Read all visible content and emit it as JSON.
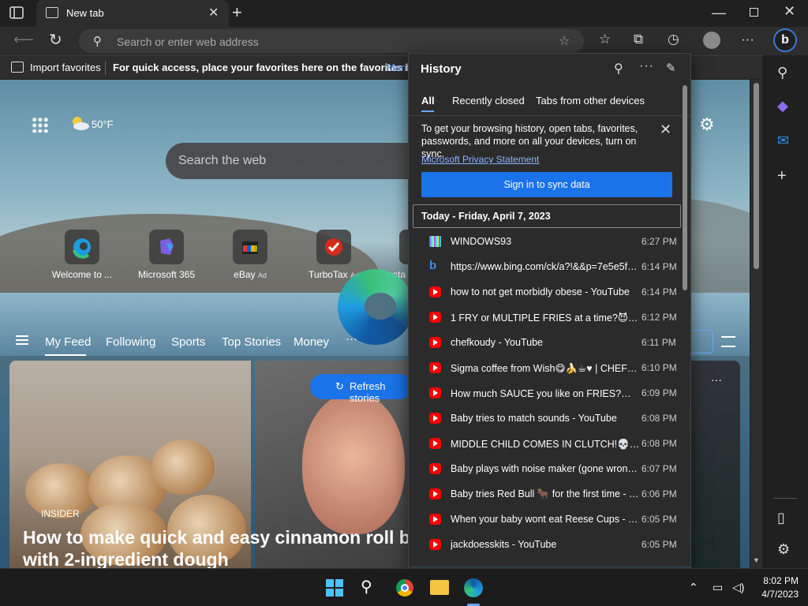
{
  "browser": {
    "tab_title": "New tab",
    "address_placeholder": "Search or enter web address"
  },
  "favorites_bar": {
    "import_label": "Import favorites",
    "hint": "For quick access, place your favorites here on the favorites bar.",
    "manage_link": "Mana"
  },
  "newtab": {
    "weather_temp": "50°F",
    "search_placeholder": "Search the web",
    "quick_links": [
      {
        "label": "Welcome to ...",
        "tag": ""
      },
      {
        "label": "Microsoft 365",
        "tag": ""
      },
      {
        "label": "eBay",
        "tag": "Ad"
      },
      {
        "label": "TurboTax",
        "tag": "Ad"
      },
      {
        "label": "Insta",
        "tag": ""
      }
    ],
    "feed_tabs": [
      "My Feed",
      "Following",
      "Sports",
      "Top Stories",
      "Money"
    ],
    "feed_more": "···",
    "refresh_label": "Refresh stories",
    "card_more": "···",
    "news_source": "INSIDER",
    "news_title": "How to make quick and easy cinnamon roll b with 2-ingredient dough"
  },
  "history": {
    "title": "History",
    "tabs": [
      "All",
      "Recently closed",
      "Tabs from other devices"
    ],
    "sync_message": "To get your browsing history, open tabs, favorites, passwords, and more on all your devices, turn on sync.",
    "privacy_link": "Microsoft Privacy Statement",
    "sign_in_label": "Sign in to sync data",
    "date_header": "Today - Friday, April 7, 2023",
    "items": [
      {
        "title": "WINDOWS93",
        "time": "6:27 PM",
        "icon": "windows93-icon"
      },
      {
        "title": "https://www.bing.com/ck/a?!&&p=7e5e5f9...",
        "time": "6:14 PM",
        "icon": "bing-icon"
      },
      {
        "title": "how to not get morbidly obese - YouTube",
        "time": "6:14 PM",
        "icon": "youtube-icon"
      },
      {
        "title": "1 FRY or MULTIPLE FRIES at a time?😈🔥 ...",
        "time": "6:12 PM",
        "icon": "youtube-icon"
      },
      {
        "title": "chefkoudy - YouTube",
        "time": "6:11 PM",
        "icon": "youtube-icon"
      },
      {
        "title": "Sigma coffee from Wish😋🍌☕♥ | CHEFK...",
        "time": "6:10 PM",
        "icon": "youtube-icon"
      },
      {
        "title": "How much SAUCE you like on FRIES?😋🍌 ...",
        "time": "6:09 PM",
        "icon": "youtube-icon"
      },
      {
        "title": "Baby tries to match sounds - YouTube",
        "time": "6:08 PM",
        "icon": "youtube-icon"
      },
      {
        "title": "MIDDLE CHILD COMES IN CLUTCH!💀😂 ...",
        "time": "6:08 PM",
        "icon": "youtube-icon"
      },
      {
        "title": "Baby plays with noise maker (gone wrong) ...",
        "time": "6:07 PM",
        "icon": "youtube-icon"
      },
      {
        "title": "Baby tries Red Bull 🐂 for the first time - Y...",
        "time": "6:06 PM",
        "icon": "youtube-icon"
      },
      {
        "title": "When your baby wont eat Reese Cups - Yo...",
        "time": "6:05 PM",
        "icon": "youtube-icon"
      },
      {
        "title": "jackdoesskits - YouTube",
        "time": "6:05 PM",
        "icon": "youtube-icon"
      }
    ]
  },
  "taskbar": {
    "time": "8:02 PM",
    "date": "4/7/2023"
  },
  "colors": {
    "accent": "#1a73e8",
    "link": "#8ab4ff",
    "youtube": "#ff0000"
  }
}
